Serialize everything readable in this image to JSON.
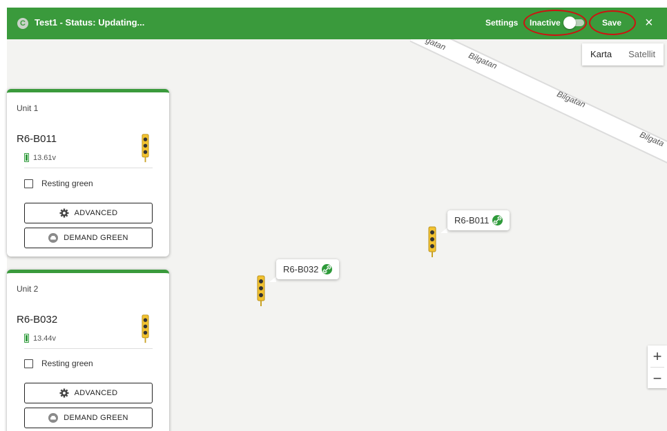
{
  "header": {
    "title": "Test1  - Status: Updating...",
    "settings_label": "Settings",
    "status_toggle_label": "Inactive",
    "save_label": "Save",
    "close_glyph": "×"
  },
  "map": {
    "type_buttons": [
      "Karta",
      "Satellit"
    ],
    "street_labels": [
      "gatan",
      "Bilgatan",
      "Bilgatan",
      "Bilgata"
    ],
    "zoom_in": "+",
    "zoom_out": "−",
    "markers": [
      {
        "label": "R6-B011"
      },
      {
        "label": "R6-B032"
      }
    ]
  },
  "units": [
    {
      "title": "Unit 1",
      "device": "R6-B011",
      "voltage": "13.61v",
      "resting_label": "Resting green",
      "advanced_label": "ADVANCED",
      "demand_label": "DEMAND GREEN"
    },
    {
      "title": "Unit 2",
      "device": "R6-B032",
      "voltage": "13.44v",
      "resting_label": "Resting green",
      "advanced_label": "ADVANCED",
      "demand_label": "DEMAND GREEN"
    }
  ],
  "colors": {
    "accent_green": "#3a9a3c",
    "highlight_ring": "#d01010",
    "signal_yellow": "#f2c230"
  },
  "icons": {
    "advanced": "gear-icon",
    "demand": "car-icon",
    "link": "link-icon",
    "battery": "battery-icon"
  }
}
